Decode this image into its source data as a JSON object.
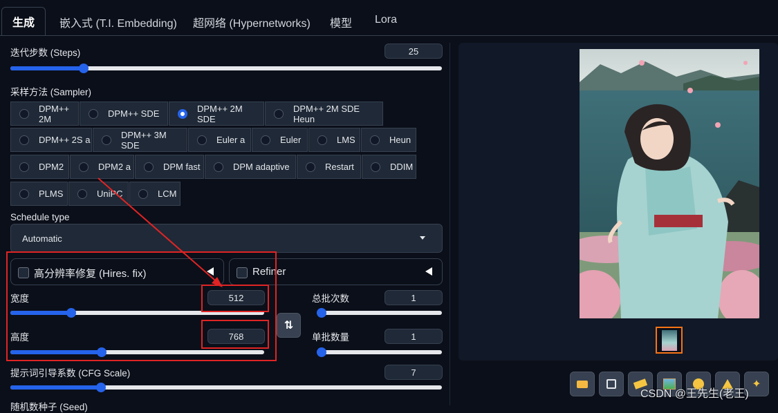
{
  "tabs": [
    "生成",
    "嵌入式 (T.I. Embedding)",
    "超网络 (Hypernetworks)",
    "模型",
    "Lora"
  ],
  "steps": {
    "label": "迭代步数 (Steps)",
    "value": "25",
    "level": 0.17
  },
  "sampler": {
    "label": "采样方法 (Sampler)",
    "selected": "DPM++ 2M SDE",
    "options": [
      "DPM++ 2M",
      "DPM++ SDE",
      "DPM++ 2M SDE",
      "DPM++ 2M SDE Heun",
      "DPM++ 2S a",
      "DPM++ 3M SDE",
      "Euler a",
      "Euler",
      "LMS",
      "Heun",
      "DPM2",
      "DPM2 a",
      "DPM fast",
      "DPM adaptive",
      "Restart",
      "DDIM",
      "PLMS",
      "UniPC",
      "LCM"
    ]
  },
  "schedule": {
    "label": "Schedule type",
    "value": "Automatic"
  },
  "hires": {
    "label": "高分辨率修复 (Hires. fix)"
  },
  "refiner": {
    "label": "Refiner"
  },
  "width": {
    "label": "宽度",
    "value": "512",
    "level": 0.24
  },
  "height": {
    "label": "高度",
    "value": "768",
    "level": 0.36
  },
  "batch_count": {
    "label": "总批次数",
    "value": "1",
    "level": 0.0
  },
  "batch_size": {
    "label": "单批数量",
    "value": "1",
    "level": 0.0
  },
  "cfg": {
    "label": "提示词引导系数 (CFG Scale)",
    "value": "7",
    "level": 0.21
  },
  "seed": {
    "label": "随机数种子 (Seed)"
  },
  "watermark": "CSDN @王先生(老王)",
  "colors": {
    "accent": "#2563eb",
    "annotation": "#e02424",
    "bg": "#0b0f19"
  },
  "tool_icons": [
    "folder-icon",
    "save-icon",
    "zip-icon",
    "image-icon",
    "palette-icon",
    "ruler-icon",
    "sparkle-icon"
  ]
}
